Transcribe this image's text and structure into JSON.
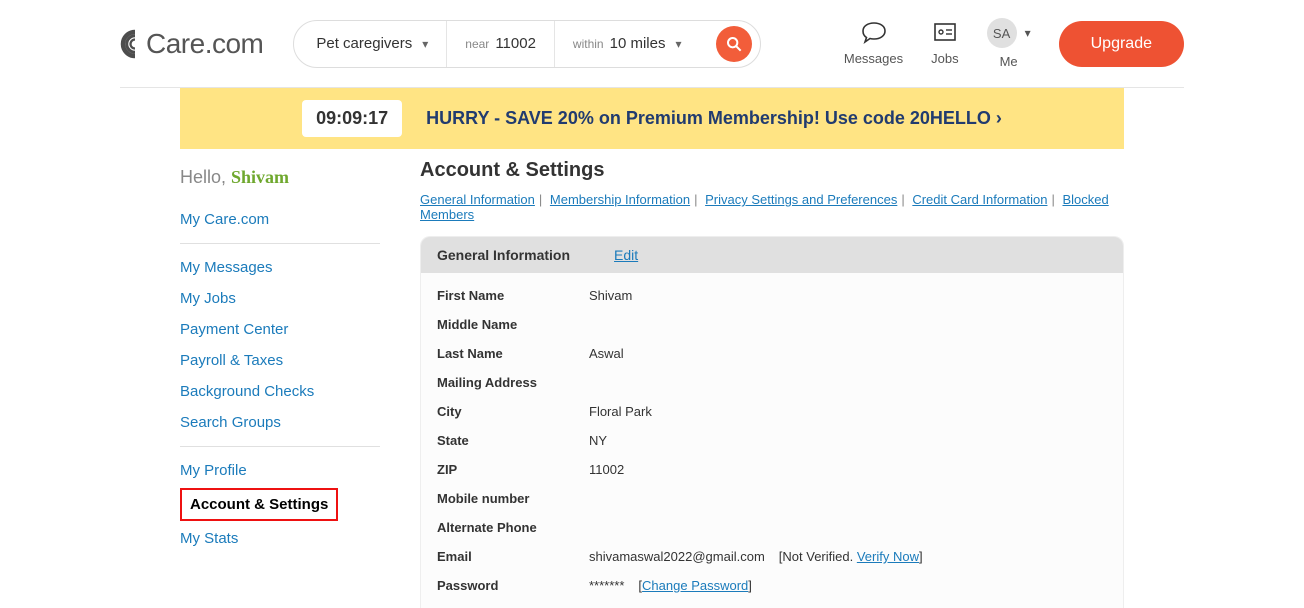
{
  "logo_text": "Care.com",
  "search": {
    "category": "Pet caregivers",
    "near_label": "near",
    "near_value": "11002",
    "within_label": "within",
    "within_value": "10 miles"
  },
  "header": {
    "messages": "Messages",
    "jobs": "Jobs",
    "me": "Me",
    "avatar_initials": "SA",
    "upgrade": "Upgrade"
  },
  "promo": {
    "timer": "09:09:17",
    "text": "HURRY - SAVE 20% on Premium Membership! Use code 20HELLO ›"
  },
  "sidebar": {
    "hello": "Hello, ",
    "name": "Shivam",
    "items": [
      "My Care.com",
      "My Messages",
      "My Jobs",
      "Payment Center",
      "Payroll & Taxes",
      "Background Checks",
      "Search Groups",
      "My Profile",
      "Account & Settings",
      "My Stats"
    ]
  },
  "content": {
    "title": "Account & Settings",
    "links": [
      "General Information",
      "Membership Information",
      "Privacy Settings and Preferences",
      "Credit Card Information",
      "Blocked Members"
    ],
    "panel_title": "General Information",
    "edit": "Edit",
    "fields": {
      "first_name_label": "First Name",
      "first_name_value": "Shivam",
      "middle_name_label": "Middle Name",
      "middle_name_value": "",
      "last_name_label": "Last Name",
      "last_name_value": "Aswal",
      "mailing_label": "Mailing Address",
      "mailing_value": "",
      "city_label": "City",
      "city_value": "Floral Park",
      "state_label": "State",
      "state_value": "NY",
      "zip_label": "ZIP",
      "zip_value": "11002",
      "mobile_label": "Mobile number",
      "mobile_value": "",
      "alt_phone_label": "Alternate Phone",
      "alt_phone_value": "",
      "email_label": "Email",
      "email_value": "shivamaswal2022@gmail.com",
      "email_status_prefix": "[Not Verified. ",
      "email_verify": "Verify Now",
      "email_status_suffix": "]",
      "password_label": "Password",
      "password_value": "*******",
      "change_password": "Change Password"
    }
  }
}
